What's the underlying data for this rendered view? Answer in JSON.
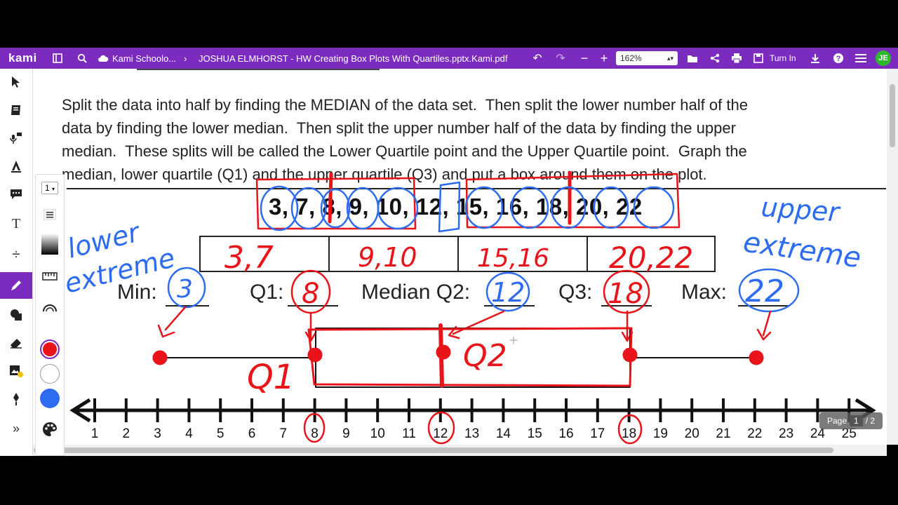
{
  "topbar": {
    "logo": "kami",
    "breadcrumb_folder": "Kami Schoolo...",
    "breadcrumb_file": "JOSHUA ELMHORST - HW Creating Box Plots With Quartiles.pptx.Kami.pdf",
    "zoom": "162%",
    "turn_in": "Turn In",
    "avatar_initials": "JE",
    "icons": [
      "sidebar-icon",
      "search-icon",
      "cloud-icon",
      "undo-icon",
      "redo-icon",
      "zoom-out-icon",
      "zoom-in-icon",
      "folder-icon",
      "share-icon",
      "print-icon",
      "save-icon",
      "download-icon",
      "help-icon",
      "menu-icon"
    ]
  },
  "left_toolbar": {
    "icons": [
      "select-icon",
      "reader-icon",
      "text-to-speech-icon",
      "markup-icon",
      "comment-icon",
      "text-icon",
      "equation-icon",
      "drawing-icon",
      "shapes-icon",
      "eraser-icon",
      "add-media-icon",
      "signature-icon",
      "expand-icon"
    ]
  },
  "sub_toolbar": {
    "stroke_width": "1",
    "colors": [
      "#e8141a",
      "#ffffff",
      "#2d6cf0"
    ]
  },
  "document": {
    "instructions": [
      "Split the data into half by finding the MEDIAN of the data set.  Then split the lower number half of the",
      "data by finding the lower median.  Then split the upper number half of the data by finding the upper",
      "median.  These splits will be called the Lower Quartile point and the Upper Quartile point.  Graph the",
      "median, lower quartile (Q1) and the upper quartile (Q3) and put a box around them on the plot."
    ],
    "data_set": "3, 7, 8, 9, 10, 12, 15, 16, 18, 20, 22",
    "labels": {
      "min": "Min:",
      "q1": "Q1:",
      "median": "Median Q2:",
      "q3": "Q3:",
      "max": "Max:"
    },
    "number_line": [
      "1",
      "2",
      "3",
      "4",
      "5",
      "6",
      "7",
      "8",
      "9",
      "10",
      "11",
      "12",
      "13",
      "14",
      "15",
      "16",
      "17",
      "18",
      "19",
      "20",
      "21",
      "22",
      "23",
      "24",
      "25"
    ]
  },
  "annotations": {
    "table_cells": [
      "3,7",
      "9,10",
      "15,16",
      "20,22"
    ],
    "min_value": "3",
    "q1_value": "8",
    "median_value": "12",
    "q3_value": "18",
    "max_value": "22",
    "lower_extreme": [
      "lower",
      "extreme"
    ],
    "upper_extreme": [
      "upper",
      "extreme"
    ],
    "q1_label": "Q1",
    "q2_label": "Q2",
    "colors": {
      "red": "#e8141a",
      "blue": "#2d6cf0"
    }
  },
  "page": {
    "label": "Page",
    "current": "1",
    "total": "/ 2"
  }
}
